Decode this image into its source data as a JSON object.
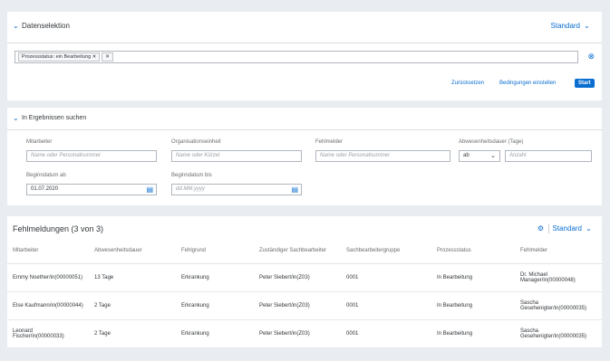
{
  "filter_panel": {
    "title": "Datenselektion",
    "variant": "Standard",
    "tokens": [
      "Prozessstatus: ein Bearbeitung"
    ],
    "reset_label": "Zurücksetzen",
    "conditions_label": "Bedingungen einstellen",
    "start_label": "Start"
  },
  "search_panel": {
    "title": "In Ergebnissen suchen",
    "fields": {
      "employee": {
        "label": "Mitarbeiter",
        "placeholder": "Name oder Personalnummer"
      },
      "org_unit": {
        "label": "Organisationseinheit",
        "placeholder": "Name oder Kürzel"
      },
      "reporter": {
        "label": "Fehlmelder",
        "placeholder": "Name oder Personalnummer"
      },
      "duration": {
        "label": "Abwesenheitsdauer (Tage)",
        "operator": "ab",
        "placeholder": "Anzahl"
      },
      "start_from": {
        "label": "Beginndatum ab",
        "value": "01.07.2020"
      },
      "start_to": {
        "label": "Beginndatum bis",
        "placeholder": "dd.MM.yyyy"
      }
    }
  },
  "results": {
    "title": "Fehlmeldungen (3 von 3)",
    "variant": "Standard",
    "columns": [
      "Mitarbeiter",
      "Abwesenheitsdauer",
      "Fehlgrund",
      "Zuständiger Sachbearbeiter",
      "Sachbearbeitergruppe",
      "Prozessstatus",
      "Fehlmelder"
    ],
    "rows": [
      [
        "Emmy Noether/in(00000051)",
        "13 Tage",
        "Erkrankung",
        "Peter Siebert/in(Z03)",
        "0001",
        "In Bearbeitung",
        "Dr. Michael Manager/in(00000048)"
      ],
      [
        "Else Kaufmann/in(00000044)",
        "2 Tage",
        "Erkrankung",
        "Peter Siebert/in(Z03)",
        "0001",
        "In Bearbeitung",
        "Sascha Gesehenigter/in(00000035)"
      ],
      [
        "Leonard Fischer/in(00000033)",
        "2 Tage",
        "Erkrankung",
        "Peter Siebert/in(Z03)",
        "0001",
        "In Bearbeitung",
        "Sascha Gesehenigter/in(00000035)"
      ]
    ]
  }
}
